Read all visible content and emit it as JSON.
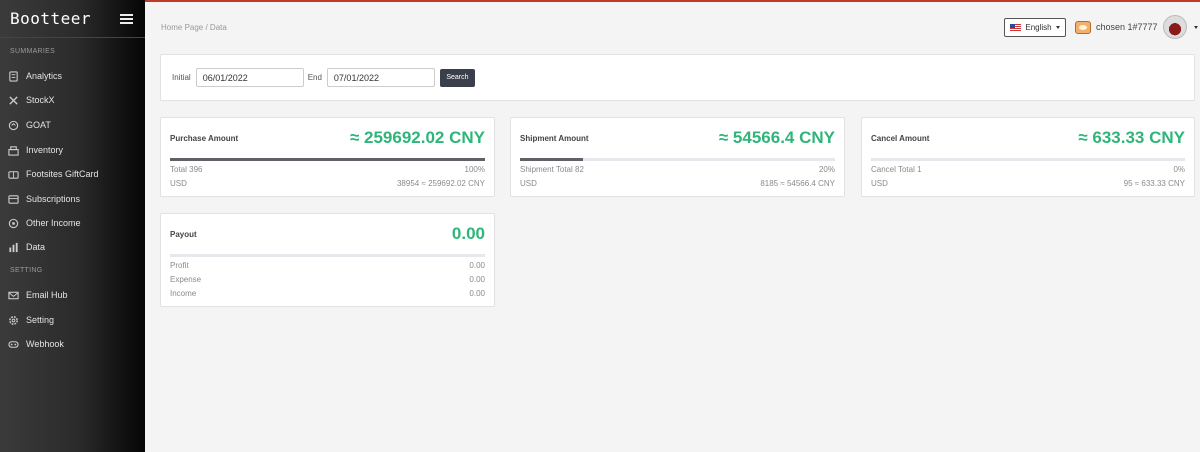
{
  "app": {
    "brand": "Bootteer"
  },
  "sidebar": {
    "sections": [
      {
        "label": "SUMMARIES"
      },
      {
        "label": "SETTING"
      }
    ],
    "items": [
      {
        "label": "Analytics",
        "icon": "analytics-icon"
      },
      {
        "label": "StockX",
        "icon": "stockx-icon"
      },
      {
        "label": "GOAT",
        "icon": "goat-icon"
      },
      {
        "label": "Inventory",
        "icon": "inventory-icon"
      },
      {
        "label": "Footsites GiftCard",
        "icon": "giftcard-icon"
      },
      {
        "label": "Subscriptions",
        "icon": "subscriptions-icon"
      },
      {
        "label": "Other Income",
        "icon": "income-icon"
      },
      {
        "label": "Data",
        "icon": "data-icon"
      },
      {
        "label": "Email Hub",
        "icon": "email-icon"
      },
      {
        "label": "Setting",
        "icon": "gear-icon"
      },
      {
        "label": "Webhook",
        "icon": "webhook-icon"
      }
    ]
  },
  "breadcrumb": "Home Page / Data",
  "header": {
    "language": "English",
    "username": "chosen 1#7777"
  },
  "search": {
    "initial_label": "Initial",
    "initial_value": "06/01/2022",
    "end_label": "End",
    "end_value": "07/01/2022",
    "button": "Search"
  },
  "cards": {
    "purchase": {
      "title": "Purchase Amount",
      "amount": "≈ 259692.02 CNY",
      "progress": 1.0,
      "row1_label": "Total 396",
      "row1_value": "100%",
      "row2_label": "USD",
      "row2_value": "38954 ≈ 259692.02 CNY"
    },
    "shipment": {
      "title": "Shipment Amount",
      "amount": "≈ 54566.4 CNY",
      "progress": 0.2,
      "row1_label": "Shipment Total 82",
      "row1_value": "20%",
      "row2_label": "USD",
      "row2_value": "8185 ≈ 54566.4 CNY"
    },
    "cancel": {
      "title": "Cancel Amount",
      "amount": "≈ 633.33 CNY",
      "progress": 0.0,
      "row1_label": "Cancel Total 1",
      "row1_value": "0%",
      "row2_label": "USD",
      "row2_value": "95 ≈ 633.33 CNY"
    },
    "payout": {
      "title": "Payout",
      "amount": "0.00",
      "profit_label": "Profit",
      "profit_value": "0.00",
      "expense_label": "Expense",
      "expense_value": "0.00",
      "income_label": "Income",
      "income_value": "0.00"
    }
  },
  "colors": {
    "accent_green": "#2fb57a",
    "top_line": "#c0392b",
    "button_dark": "#3a3f4b"
  }
}
